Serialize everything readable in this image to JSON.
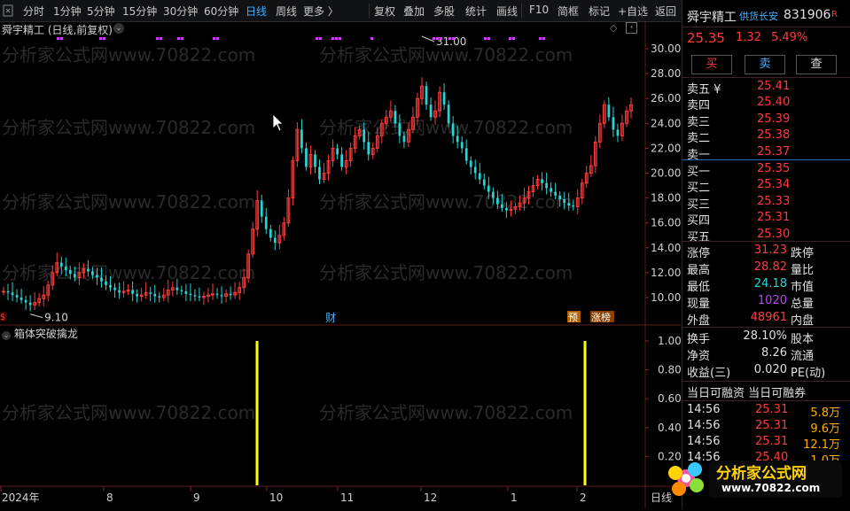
{
  "toolbar": {
    "items": [
      "分时",
      "1分钟",
      "5分钟",
      "15分钟",
      "30分钟",
      "60分钟",
      "日线",
      "周线",
      "更多 〉",
      "复权",
      "叠加",
      "多股",
      "统计",
      "画线",
      "F10",
      "简框",
      "标记",
      "+自选",
      "返回"
    ],
    "active_index": 6
  },
  "chart": {
    "title": "舜宇精工 (日线,前复权)",
    "y_ticks": [
      "30.00",
      "28.00",
      "26.00",
      "24.00",
      "22.00",
      "20.00",
      "18.00",
      "16.00",
      "14.00",
      "12.00",
      "10.00"
    ],
    "high_label": "31.00",
    "low_label": "9.10",
    "markers": {
      "cai": "财",
      "yu": "预",
      "zhang": "涨榜"
    },
    "indicator_title": "箱体突破擒龙",
    "indicator_ticks": [
      "1.00",
      "0.80",
      "0.60",
      "0.40",
      "0.20"
    ],
    "x_labels": [
      "2024年",
      "8",
      "9",
      "10",
      "11",
      "12",
      "1",
      "2"
    ],
    "x_end_label": "日线",
    "watermark": "分析家公式网www.70822.com",
    "colors": {
      "up": "#ff3b3b",
      "down": "#27d3d3",
      "signal": "#ffff00",
      "grid": "#3a1414"
    }
  },
  "chart_data": {
    "type": "candlestick",
    "price_range": [
      9.0,
      31.0
    ],
    "high_marker": 31.0,
    "low_marker": 9.1,
    "close_approx": [
      10.5,
      10.4,
      10.2,
      10.0,
      9.8,
      9.6,
      9.4,
      9.6,
      9.9,
      10.2,
      11.0,
      12.0,
      12.8,
      12.5,
      12.2,
      11.9,
      11.6,
      12.0,
      12.3,
      12.1,
      11.8,
      11.6,
      11.3,
      11.0,
      10.8,
      10.6,
      10.4,
      10.5,
      10.6,
      10.3,
      10.1,
      10.2,
      10.4,
      10.3,
      10.1,
      10.0,
      10.2,
      10.6,
      10.8,
      10.6,
      10.5,
      10.3,
      10.2,
      10.1,
      10.0,
      10.1,
      10.2,
      10.3,
      10.2,
      10.1,
      10.3,
      10.2,
      10.4,
      10.8,
      11.6,
      13.5,
      15.5,
      17.8,
      16.5,
      15.5,
      14.8,
      14.4,
      15.0,
      16.0,
      18.0,
      21.0,
      23.5,
      22.0,
      20.5,
      21.5,
      20.5,
      19.5,
      20.0,
      21.0,
      22.0,
      21.5,
      20.5,
      21.0,
      22.0,
      23.0,
      23.5,
      22.5,
      21.5,
      22.0,
      23.0,
      24.0,
      24.5,
      25.0,
      24.0,
      23.0,
      22.5,
      23.5,
      24.5,
      26.0,
      27.0,
      25.5,
      24.5,
      25.0,
      26.5,
      25.5,
      24.0,
      23.0,
      22.5,
      22.0,
      21.0,
      20.5,
      20.0,
      19.5,
      19.0,
      18.5,
      18.0,
      17.5,
      17.2,
      17.0,
      17.1,
      17.3,
      17.6,
      18.0,
      18.5,
      19.0,
      19.5,
      19.2,
      18.8,
      18.5,
      18.2,
      17.9,
      17.6,
      17.4,
      17.3,
      18.0,
      19.2,
      20.0,
      20.6,
      22.5,
      24.0,
      25.5,
      24.5,
      23.5,
      23.0,
      24.0,
      25.0,
      25.5
    ],
    "indicator": {
      "name": "箱体突破擒龙",
      "ylim": [
        0,
        1
      ],
      "signals": [
        1,
        1
      ]
    }
  },
  "panel": {
    "stock_name": "舜宇精工",
    "tag": "供货长安",
    "code": "831906",
    "r_badge": "R",
    "price": "25.35",
    "change": "1.32",
    "change_pct": "5.49%",
    "buttons": [
      "买",
      "卖",
      "查"
    ],
    "sell": [
      {
        "label": "卖五 ¥",
        "price": "25.41"
      },
      {
        "label": "卖四",
        "price": "25.40"
      },
      {
        "label": "卖三",
        "price": "25.39"
      },
      {
        "label": "卖二",
        "price": "25.38"
      },
      {
        "label": "卖一",
        "price": "25.37"
      }
    ],
    "buy": [
      {
        "label": "买一",
        "price": "25.35"
      },
      {
        "label": "买二",
        "price": "25.34"
      },
      {
        "label": "买三",
        "price": "25.33"
      },
      {
        "label": "买四",
        "price": "25.31"
      },
      {
        "label": "买五",
        "price": "25.30"
      }
    ],
    "stats1": [
      {
        "l": "涨停",
        "v": "31.23",
        "r": "跌停"
      },
      {
        "l": "最高",
        "v": "28.82",
        "r": "量比"
      },
      {
        "l": "最低",
        "v": "24.18",
        "r": "市值"
      },
      {
        "l": "现量",
        "v": "1020",
        "r": "总量"
      },
      {
        "l": "外盘",
        "v": "48961",
        "r": "内盘"
      }
    ],
    "stats2": [
      {
        "l": "换手",
        "v": "28.10%",
        "r": "股本"
      },
      {
        "l": "净资",
        "v": "8.26",
        "r": "流通"
      },
      {
        "l": "收益(三)",
        "v": "0.020",
        "r": "PE(动)"
      }
    ],
    "margin_header": "当日可融资 当日可融券",
    "ticks": [
      {
        "t": "14:56",
        "p": "25.31",
        "v": "5.8万"
      },
      {
        "t": "14:56",
        "p": "25.31",
        "v": "9.6万"
      },
      {
        "t": "14:56",
        "p": "25.31",
        "v": "12.1万"
      },
      {
        "t": "14:56",
        "p": "25.40",
        "v": "1.0万"
      }
    ]
  },
  "logo": {
    "text": "分析家公式网",
    "url": "www.70822.com"
  }
}
